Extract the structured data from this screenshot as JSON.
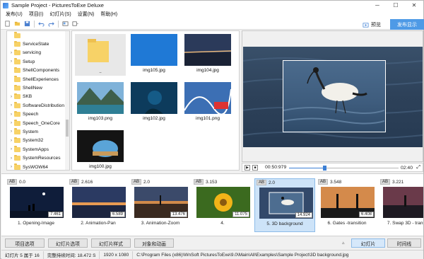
{
  "window": {
    "title": "Sample Project - PicturesToExe Deluxe"
  },
  "menu": [
    "发布(U)",
    "项目(I)",
    "幻灯片(S)",
    "设置(N)",
    "帮助(H)"
  ],
  "toolbar": {
    "preview_label": "预览",
    "publish_label": "发布显示"
  },
  "folders": [
    {
      "label": "",
      "arrow": ""
    },
    {
      "label": "ServiceState",
      "arrow": ""
    },
    {
      "label": "servicing",
      "arrow": "›"
    },
    {
      "label": "Setup",
      "arrow": "›"
    },
    {
      "label": "ShellComponents",
      "arrow": ""
    },
    {
      "label": "ShellExperiences",
      "arrow": ""
    },
    {
      "label": "ShellNew",
      "arrow": ""
    },
    {
      "label": "SKB",
      "arrow": "›"
    },
    {
      "label": "SoftwareDistribution",
      "arrow": "›"
    },
    {
      "label": "Speech",
      "arrow": "›"
    },
    {
      "label": "Speech_OneCore",
      "arrow": "›"
    },
    {
      "label": "System",
      "arrow": "›"
    },
    {
      "label": "System32",
      "arrow": "›"
    },
    {
      "label": "SystemApps",
      "arrow": "›"
    },
    {
      "label": "SystemResources",
      "arrow": "›"
    },
    {
      "label": "SysWOW64",
      "arrow": "›"
    },
    {
      "label": "TAPI",
      "arrow": ""
    }
  ],
  "files": [
    {
      "name": "..",
      "kind": "folder"
    },
    {
      "name": "img105.jpg",
      "kind": "blue"
    },
    {
      "name": "img104.jpg",
      "kind": "dusk"
    },
    {
      "name": "img103.png",
      "kind": "lake"
    },
    {
      "name": "img102.jpg",
      "kind": "underwater"
    },
    {
      "name": "img101.png",
      "kind": "rollercoaster"
    },
    {
      "name": "img100.jpg",
      "kind": "cave"
    }
  ],
  "player": {
    "time_current": "00:50:979",
    "time_total": "02:40",
    "progress": 0.32
  },
  "slides": [
    {
      "ab": "AB",
      "time": "0.0",
      "duration": "7.461",
      "title": "1. Opening-Image",
      "kind": "night"
    },
    {
      "ab": "AB",
      "time": "2.616",
      "duration": "6.589",
      "title": "2. Animation-Pan",
      "kind": "sunset"
    },
    {
      "ab": "AB",
      "time": "2.0",
      "duration": "13.476",
      "title": "3. Animation-Zoom",
      "kind": "field"
    },
    {
      "ab": "AB",
      "time": "3.153",
      "duration": "11.075",
      "title": "4.",
      "kind": "flower"
    },
    {
      "ab": "AB",
      "time": "2.0",
      "duration": "14.924",
      "title": "5. 3D background",
      "kind": "bird",
      "selected": true
    },
    {
      "ab": "AB",
      "time": "3.548",
      "duration": "6.408",
      "title": "6. Gates -transition",
      "kind": "gates"
    },
    {
      "ab": "AB",
      "time": "3.221",
      "duration": "",
      "title": "7. Swap 3D - transitio",
      "kind": "dusk"
    }
  ],
  "bottom_buttons": {
    "project_options": "项目选项",
    "slide_options": "幻灯片选项",
    "slide_style": "幻灯片样式",
    "objects_animation": "对象和动画",
    "slides_tab": "幻灯片",
    "timeline_tab": "时间线"
  },
  "status": {
    "slide_info": "幻灯片 5 属于 16",
    "total_duration": "完整持续时间: 18.472 S",
    "resolution": "1920 x 1080",
    "path": "C:\\Program Files (x86)\\WnSoft PicturesToExe\\9.0\\Main\\All\\Examples\\Sample Project\\3D background.jpg"
  }
}
